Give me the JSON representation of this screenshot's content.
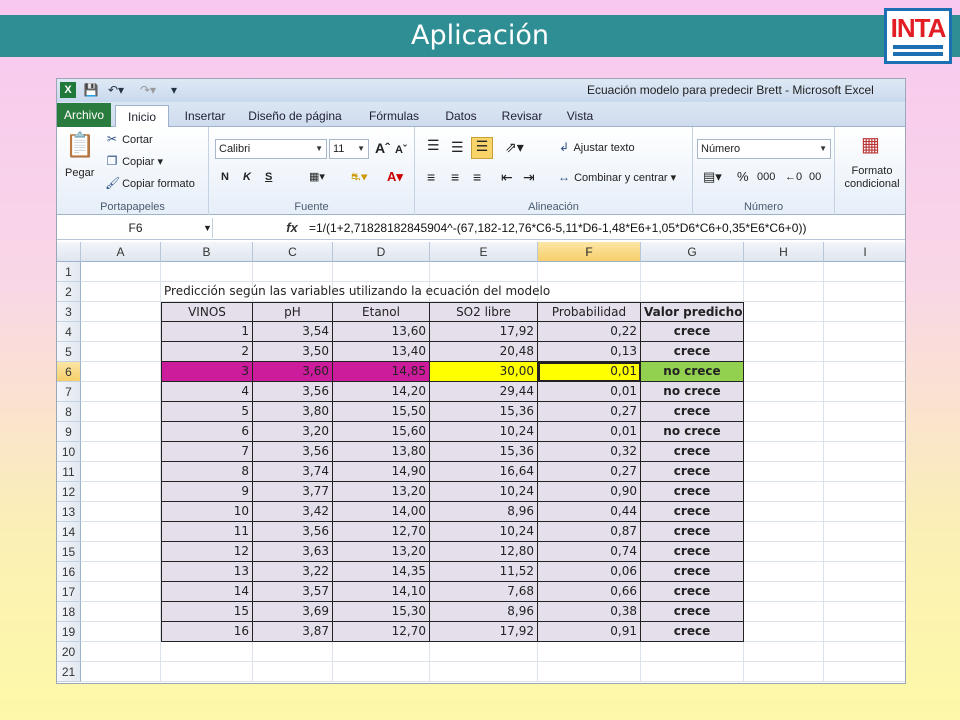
{
  "slide": {
    "title": "Aplicación",
    "logo": "INTA"
  },
  "window": {
    "title": "Ecuación modelo para predecir Brett - Microsoft Excel",
    "app_icon": "X"
  },
  "tabs": [
    "Archivo",
    "Inicio",
    "Insertar",
    "Diseño de página",
    "Fórmulas",
    "Datos",
    "Revisar",
    "Vista"
  ],
  "ribbon": {
    "clipboard": {
      "paste": "Pegar",
      "cut": "Cortar",
      "copy": "Copiar",
      "format_painter": "Copiar formato",
      "label": "Portapapeles"
    },
    "font": {
      "name": "Calibri",
      "size": "11",
      "bold": "N",
      "italic": "K",
      "underline": "S",
      "label": "Fuente"
    },
    "alignment": {
      "wrap": "Ajustar texto",
      "merge": "Combinar y centrar",
      "label": "Alineación"
    },
    "number": {
      "format": "Número",
      "percent": "%",
      "thousands": "000",
      "label": "Número"
    },
    "styles": {
      "conditional": "Formato condicional"
    }
  },
  "formula_bar": {
    "name_box": "F6",
    "fx": "fx",
    "formula": "=1/(1+2,71828182845904^-(67,182-12,76*C6-5,11*D6-1,48*E6+1,05*D6*C6+0,35*E6*C6+0))"
  },
  "sheet": {
    "columns": [
      "A",
      "B",
      "C",
      "D",
      "E",
      "F",
      "G",
      "H",
      "I"
    ],
    "rows": [
      "1",
      "2",
      "3",
      "4",
      "5",
      "6",
      "7",
      "8",
      "9",
      "10",
      "11",
      "12",
      "13",
      "14",
      "15",
      "16",
      "17",
      "18",
      "19",
      "20",
      "21"
    ],
    "caption": "Predicción según las variables utilizando la ecuación del modelo",
    "headers": [
      "VINOS",
      "pH",
      "Etanol",
      "SO2 libre",
      "Probabilidad",
      "Valor predicho"
    ],
    "data": [
      [
        "1",
        "3,54",
        "13,60",
        "17,92",
        "0,22",
        "crece"
      ],
      [
        "2",
        "3,50",
        "13,40",
        "20,48",
        "0,13",
        "crece"
      ],
      [
        "3",
        "3,60",
        "14,85",
        "30,00",
        "0,01",
        "no crece"
      ],
      [
        "4",
        "3,56",
        "14,20",
        "29,44",
        "0,01",
        "no crece"
      ],
      [
        "5",
        "3,80",
        "15,50",
        "15,36",
        "0,27",
        "crece"
      ],
      [
        "6",
        "3,20",
        "15,60",
        "10,24",
        "0,01",
        "no crece"
      ],
      [
        "7",
        "3,56",
        "13,80",
        "15,36",
        "0,32",
        "crece"
      ],
      [
        "8",
        "3,74",
        "14,90",
        "16,64",
        "0,27",
        "crece"
      ],
      [
        "9",
        "3,77",
        "13,20",
        "10,24",
        "0,90",
        "crece"
      ],
      [
        "10",
        "3,42",
        "14,00",
        "8,96",
        "0,44",
        "crece"
      ],
      [
        "11",
        "3,56",
        "12,70",
        "10,24",
        "0,87",
        "crece"
      ],
      [
        "12",
        "3,63",
        "13,20",
        "12,80",
        "0,74",
        "crece"
      ],
      [
        "13",
        "3,22",
        "14,35",
        "11,52",
        "0,06",
        "crece"
      ],
      [
        "14",
        "3,57",
        "14,10",
        "7,68",
        "0,66",
        "crece"
      ],
      [
        "15",
        "3,69",
        "15,30",
        "8,96",
        "0,38",
        "crece"
      ],
      [
        "16",
        "3,87",
        "12,70",
        "17,92",
        "0,91",
        "crece"
      ]
    ]
  },
  "colors": {
    "accent": "#2f8e94",
    "highlight_row": "#cc1c9c",
    "highlight_yellow": "#ffff00",
    "highlight_green": "#92d050",
    "table_fill": "#e5dfec"
  }
}
